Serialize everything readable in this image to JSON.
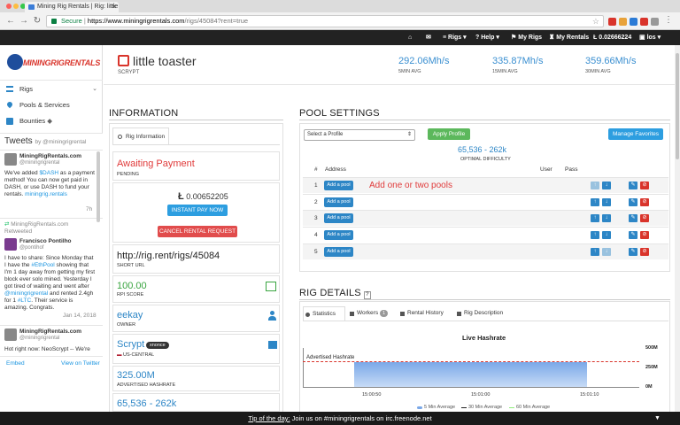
{
  "browser": {
    "tab_title": "Mining Rig Rentals | Rig: little",
    "url_secure": "Secure",
    "url_domain": "https://www.miningrigrentals.com",
    "url_path": "/rigs/45084?rent=true"
  },
  "topnav": {
    "rigs": "Rigs",
    "help": "Help",
    "my_rigs": "My Rigs",
    "my_rentals": "My Rentals",
    "balance": "0.02666224",
    "user": "los"
  },
  "sidebar": {
    "logo_text": "MININGRIGRENTALS",
    "items": [
      {
        "label": "Rigs"
      },
      {
        "label": "Pools & Services"
      },
      {
        "label": "Bounties"
      }
    ]
  },
  "tweets": {
    "title": "Tweets",
    "by": "by @miningrigrental",
    "t1_name": "MiningRigRentals.com",
    "t1_handle": "@miningrigrental",
    "t1_text_a": "We've added ",
    "t1_cashtag": "$DASH",
    "t1_text_b": " as a payment method! You can now get paid in DASH, or use DASH to fund your rentals.",
    "t1_link": "miningrig.rentals",
    "t1_time": "7h",
    "rt_by": "MiningRigRentals.com",
    "rt_label": "Retweeted",
    "t2_name": "Francisco Pontilho",
    "t2_handle": "@pontihof",
    "t2_text_a": "I have to share: Since Monday that I have the ",
    "t2_tag": "#EthPool",
    "t2_text_b": " showing that I'm 1 day away from getting my first block ever solo mined. Yesterday I got tired of waiting and went after ",
    "t2_mention": "@miningrigrental",
    "t2_text_c": " and rented 2.4gh for 1 ",
    "t2_tag2": "#LTC",
    "t2_text_d": ". Their service is amazing. Congrats.",
    "t2_time": "Jan 14, 2018",
    "t3_name": "MiningRigRentals.com",
    "t3_handle": "@miningrigrental",
    "t3_text": "Hot right now: NeoScrypt -- We're",
    "embed": "Embed",
    "view_on": "View on Twitter"
  },
  "rig": {
    "name": "little toaster",
    "algo": "SCRYPT",
    "hash_5": "292.06Mh/s",
    "hash_5_label": "5MIN AVG",
    "hash_15": "335.87Mh/s",
    "hash_15_label": "15MIN AVG",
    "hash_30": "359.66Mh/s",
    "hash_30_label": "30MIN AVG"
  },
  "info": {
    "title": "INFORMATION",
    "tab": "Rig Information",
    "status": "Awaiting Payment",
    "status_sub": "PENDING",
    "price": "0.00652205",
    "instant_pay": "INSTANT PAY NOW",
    "cancel": "CANCEL RENTAL REQUEST",
    "short_url": "http://rig.rent/rigs/45084",
    "short_url_label": "SHORT URL",
    "rpi": "100.00",
    "rpi_label": "RPI SCORE",
    "owner": "eekay",
    "owner_label": "OWNER",
    "algo": "Scrypt",
    "algo_badge": "xnonce",
    "region": "US-CENTRAL",
    "adv_hash": "325.00M",
    "adv_hash_label": "ADVERTISED HASHRATE",
    "diff": "65,536 - 262k"
  },
  "pool": {
    "title": "POOL SETTINGS",
    "select": "Select a Profile",
    "apply": "Apply Profile",
    "manage": "Manage Favorites",
    "difficulty": "65,536 - 262k",
    "difficulty_label": "OPTIMAL DIFFICULTY",
    "col_num": "#",
    "col_address": "Address",
    "col_user": "User",
    "col_pass": "Pass",
    "add_label": "Add a pool",
    "hint": "Add one or two pools",
    "rows": [
      "1",
      "2",
      "3",
      "4",
      "5"
    ]
  },
  "rig_details": {
    "title": "RIG DETAILS",
    "tabs": {
      "statistics": "Statistics",
      "workers": "Workers",
      "workers_count": "1",
      "history": "Rental History",
      "description": "Rig Description"
    },
    "chart_title": "Live Hashrate",
    "adv_label": "Advertised Hashrate",
    "y_max": "500M",
    "y_mid": "250M",
    "y_min": "0M",
    "x_ticks": [
      "15:00:50",
      "15:01:00",
      "15:01:10"
    ],
    "legend": [
      "5 Min Average",
      "30 Min Average",
      "60 Min Average"
    ],
    "colors": {
      "series_5": "#7aa8e8",
      "series_30": "#222222",
      "series_60": "#90ed7d",
      "advertised": "#d9342b"
    }
  },
  "bottom": {
    "tip_label": "Tip of the day:",
    "tip_text": " Join us on #miningrigrentals on irc.freenode.net"
  }
}
